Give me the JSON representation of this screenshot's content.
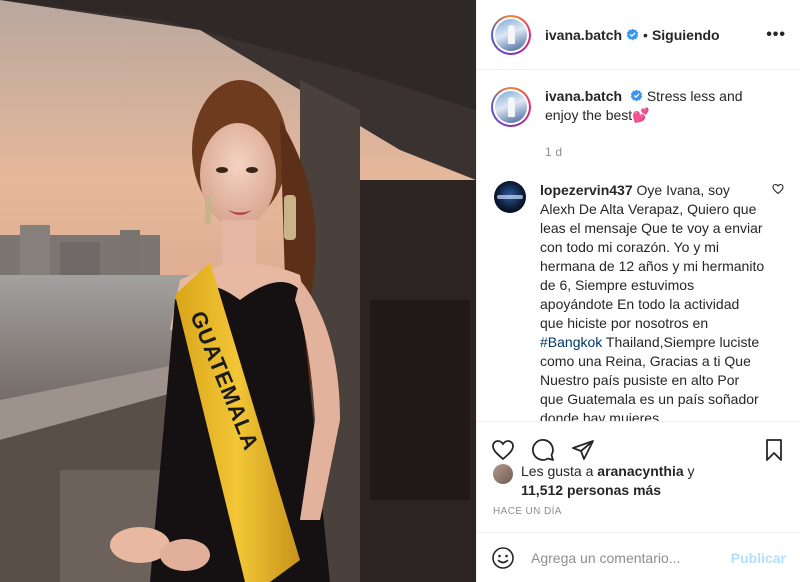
{
  "header": {
    "username": "ivana.batch",
    "separator": "•",
    "follow_status": "Siguiendo",
    "more_icon": "more-options-icon",
    "verified_color": "#3897f0"
  },
  "caption": {
    "username": "ivana.batch",
    "text": "Stress less and enjoy the best💕",
    "age": "1 d"
  },
  "comment": {
    "username": "lopezervin437",
    "text_before": "Oye Ivana, soy Alexh De Alta Verapaz, Quiero que leas el mensaje Que te voy a enviar con todo mi corazón. Yo y mi hermana de 12 años y mi hermanito de 6, Siempre estuvimos apoyándote En todo la actividad que hiciste por nosotros en",
    "hashtag": "#Bangkok",
    "text_after": "Thailand,Siempre luciste como una Reina, Gracias a ti Que Nuestro país pusiste en alto Por que Guatemala es un país soñador donde hay mujeres"
  },
  "photo": {
    "sash_text": "GUATEMALA"
  },
  "actions": {
    "like_icon": "heart-icon",
    "comment_icon": "comment-icon",
    "share_icon": "share-icon",
    "save_icon": "bookmark-icon"
  },
  "likes": {
    "prefix": "Les gusta a",
    "liker": "aranacynthia",
    "conjunction": "y",
    "count": "11,512 personas más"
  },
  "timestamp": "HACE UN DÍA",
  "add_comment": {
    "placeholder": "Agrega un comentario...",
    "post_label": "Publicar"
  }
}
